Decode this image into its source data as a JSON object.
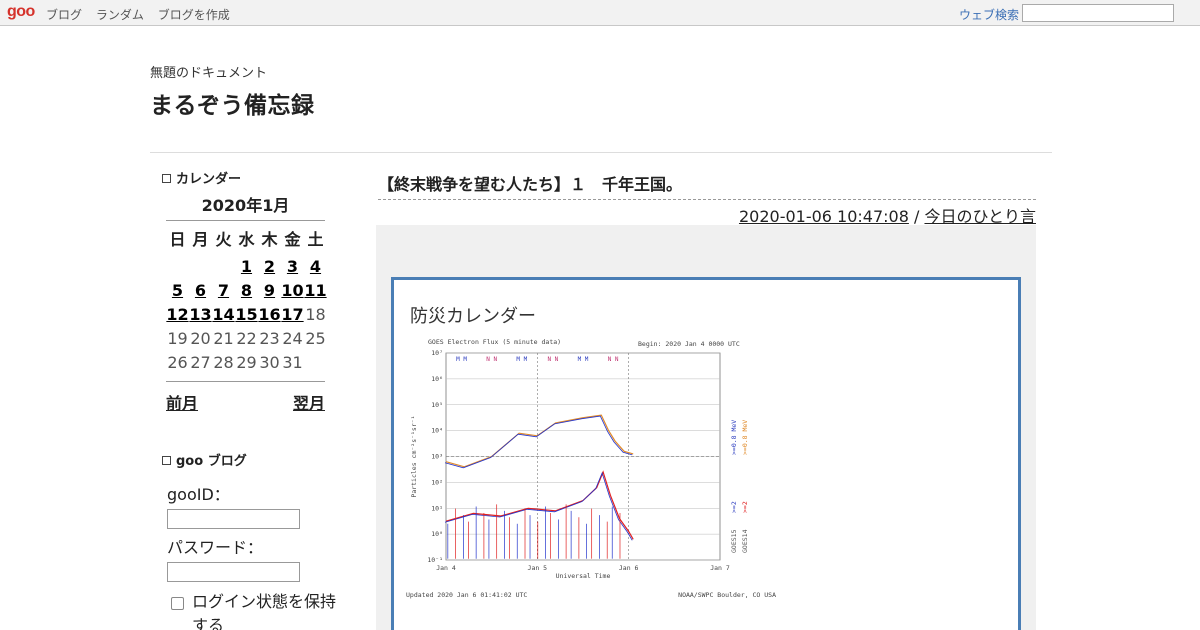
{
  "topbar": {
    "logo": "goo",
    "nav": [
      "ブログ",
      "ランダム",
      "ブログを作成"
    ],
    "search_label": "ウェブ検索"
  },
  "header": {
    "description": "無題のドキュメント",
    "title": "まるぞう備忘録"
  },
  "sidebar": {
    "calendar_heading": "カレンダー",
    "calendar_title": "2020年1月",
    "weekdays": [
      "日",
      "月",
      "火",
      "水",
      "木",
      "金",
      "土"
    ],
    "prev_label": "前月",
    "next_label": "翌月",
    "goo_heading": "goo ブログ",
    "gooid_label": "gooID：",
    "password_label": "パスワード：",
    "remember_label": "ログイン状態を保持する"
  },
  "article": {
    "title": "【終末戦争を望む人たち】１　千年王国。",
    "datetime": "2020-01-06 10:47:08",
    "separator": " / ",
    "category": "今日のひとり言",
    "embed_title": "防災カレンダー"
  },
  "chart_data": {
    "type": "line",
    "title": "GOES Electron Flux (5 minute data)",
    "begin_label": "Begin: 2020 Jan 4 0000 UTC",
    "xlabel": "Universal Time",
    "ylabel": "Particles cm⁻²s⁻¹sr⁻¹",
    "x_ticks": [
      "Jan 4",
      "Jan 5",
      "Jan 6",
      "Jan 7"
    ],
    "y_ticks": [
      "10⁻¹",
      "10¹",
      "10³",
      "10⁵",
      "10⁷"
    ],
    "y_minor_ticks": [
      "10⁰",
      "10²",
      "10⁴",
      "10⁶"
    ],
    "right_labels": [
      ">=0.8 MeV",
      ">=0.8 MeV",
      ">=2",
      ">=2",
      "GOES15",
      "GOES14"
    ],
    "footer_left": "Updated 2020 Jan  6 01:41:02 UTC",
    "footer_right": "NOAA/SWPC Boulder, CO USA",
    "marker_labels": [
      "M M",
      "N N",
      "M M",
      "N N",
      "M M",
      "N N"
    ],
    "colors": {
      "goes15_08": "#2233cc",
      "goes14_08": "#e08a2a",
      "goes15_2": "#2233cc",
      "goes14_2": "#e02020"
    },
    "series": [
      {
        "name": ">=0.8 MeV",
        "x": [
          0,
          0.2,
          0.5,
          0.8,
          1.0,
          1.2,
          1.5,
          1.7,
          1.78,
          1.85,
          1.95,
          2.05
        ],
        "values": [
          2.8,
          2.6,
          3.0,
          3.9,
          3.8,
          4.3,
          4.5,
          4.6,
          4.0,
          3.6,
          3.2,
          3.1
        ]
      },
      {
        "name": ">=2",
        "x": [
          0,
          0.3,
          0.6,
          0.9,
          1.2,
          1.5,
          1.65,
          1.72,
          1.8,
          1.9,
          2.0,
          2.05
        ],
        "values": [
          0.5,
          0.8,
          0.7,
          1.0,
          0.9,
          1.3,
          1.8,
          2.4,
          1.5,
          0.6,
          0.1,
          -0.2
        ]
      }
    ],
    "xlim": [
      0,
      3
    ],
    "ylim": [
      -1,
      7
    ]
  }
}
